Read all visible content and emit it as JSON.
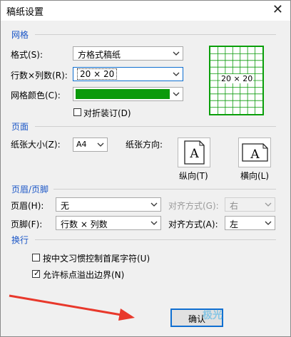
{
  "window": {
    "title": "稿纸设置",
    "close_glyph": "✕"
  },
  "sections": {
    "grid": "网格",
    "page": "页面",
    "header_footer": "页眉/页脚",
    "line_break": "换行"
  },
  "grid": {
    "style_label": "格式(S):",
    "style_value": "方格式稿纸",
    "rows_cols_label": "行数×列数(R):",
    "rows_cols_value": "20 × 20",
    "color_label": "网格颜色(C):",
    "color_value": "#0b9a0b",
    "fold_label": "对折装订(D)",
    "preview_text": "20 × 20"
  },
  "page": {
    "paper_size_label": "纸张大小(Z):",
    "paper_size_value": "A4",
    "orientation_label": "纸张方向:",
    "portrait_label": "纵向(T)",
    "landscape_label": "横向(L)",
    "orientation_glyph": "A"
  },
  "header_footer": {
    "header_label": "页眉(H):",
    "header_value": "无",
    "header_align_label": "对齐方式(G):",
    "header_align_value": "右",
    "footer_label": "页脚(F):",
    "footer_value": "行数 × 列数",
    "footer_align_label": "对齐方式(A):",
    "footer_align_value": "左"
  },
  "line_break": {
    "option1_label": "按中文习惯控制首尾字符(U)",
    "option1_checked": false,
    "option2_label": "允许标点溢出边界(N)",
    "option2_checked": true,
    "check_glyph": "✓"
  },
  "buttons": {
    "ok_label": "确认"
  },
  "watermark": {
    "text": "极光"
  },
  "colors": {
    "accent": "#1c57c7",
    "grid_green": "#0b9a0b",
    "arrow_red": "#e8382b"
  }
}
